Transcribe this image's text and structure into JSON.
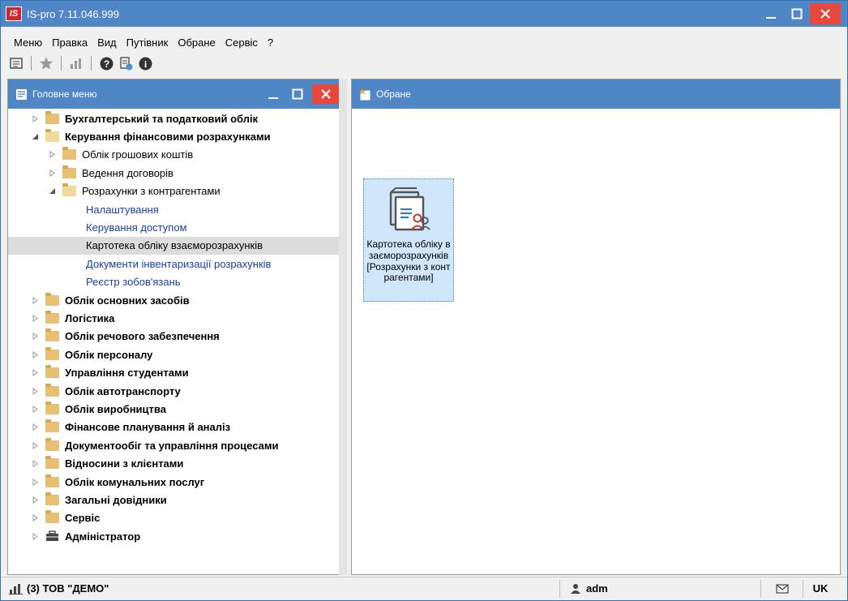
{
  "app": {
    "title": "IS-pro 7.11.046.999",
    "logo_text": "IS"
  },
  "menu": [
    "Меню",
    "Правка",
    "Вид",
    "Путівник",
    "Обране",
    "Сервіс",
    "?"
  ],
  "toolbar": {
    "icons": [
      "list-icon",
      "star-icon",
      "chart-icon",
      "help-icon",
      "info-doc-icon",
      "info-icon"
    ]
  },
  "left_panel": {
    "title": "Головне меню",
    "tree": [
      {
        "label": "Бухгалтерський та податковий облік",
        "level": 0,
        "bold": true,
        "expander": "collapsed",
        "icon": "folder"
      },
      {
        "label": "Керування фінансовими розрахунками",
        "level": 0,
        "bold": true,
        "expander": "expanded",
        "icon": "folder-open"
      },
      {
        "label": "Облік грошових коштів",
        "level": 1,
        "bold": false,
        "expander": "collapsed",
        "icon": "folder"
      },
      {
        "label": "Ведення договорів",
        "level": 1,
        "bold": false,
        "expander": "collapsed",
        "icon": "folder"
      },
      {
        "label": "Розрахунки з контрагентами",
        "level": 1,
        "bold": false,
        "expander": "expanded",
        "icon": "folder-open"
      },
      {
        "label": "Налаштування",
        "level": 2,
        "link": true
      },
      {
        "label": "Керування доступом",
        "level": 2,
        "link": true
      },
      {
        "label": "Картотека обліку взаєморозрахунків",
        "level": 2,
        "link": false,
        "selected": true
      },
      {
        "label": "Документи інвентаризації розрахунків",
        "level": 2,
        "link": true
      },
      {
        "label": "Реєстр зобов'язань",
        "level": 2,
        "link": true
      },
      {
        "label": "Облік основних засобів",
        "level": 0,
        "bold": true,
        "expander": "collapsed",
        "icon": "folder"
      },
      {
        "label": "Логістика",
        "level": 0,
        "bold": true,
        "expander": "collapsed",
        "icon": "folder"
      },
      {
        "label": "Облік речового забезпечення",
        "level": 0,
        "bold": true,
        "expander": "collapsed",
        "icon": "folder"
      },
      {
        "label": "Облік персоналу",
        "level": 0,
        "bold": true,
        "expander": "collapsed",
        "icon": "folder"
      },
      {
        "label": "Управління студентами",
        "level": 0,
        "bold": true,
        "expander": "collapsed",
        "icon": "folder"
      },
      {
        "label": "Облік автотранспорту",
        "level": 0,
        "bold": true,
        "expander": "collapsed",
        "icon": "folder"
      },
      {
        "label": "Облік виробництва",
        "level": 0,
        "bold": true,
        "expander": "collapsed",
        "icon": "folder"
      },
      {
        "label": "Фінансове планування й аналіз",
        "level": 0,
        "bold": true,
        "expander": "collapsed",
        "icon": "folder"
      },
      {
        "label": "Документообіг та управління процесами",
        "level": 0,
        "bold": true,
        "expander": "collapsed",
        "icon": "folder"
      },
      {
        "label": "Відносини з клієнтами",
        "level": 0,
        "bold": true,
        "expander": "collapsed",
        "icon": "folder"
      },
      {
        "label": "Облік комунальних послуг",
        "level": 0,
        "bold": true,
        "expander": "collapsed",
        "icon": "folder"
      },
      {
        "label": "Загальні довідники",
        "level": 0,
        "bold": true,
        "expander": "collapsed",
        "icon": "folder"
      },
      {
        "label": "Сервіс",
        "level": 0,
        "bold": true,
        "expander": "collapsed",
        "icon": "folder"
      },
      {
        "label": "Адміністратор",
        "level": 0,
        "bold": true,
        "expander": "collapsed",
        "icon": "admin"
      }
    ]
  },
  "right_panel": {
    "title": "Обране",
    "tile_label": "Картотека обліку взаєморозрахунків [Розрахунки з контрагентами]"
  },
  "statusbar": {
    "company": "(3) ТОВ \"ДЕМО\"",
    "user": "adm",
    "lang": "UK"
  },
  "colors": {
    "titlebar": "#4f86c6",
    "close": "#e8473c",
    "link": "#1a3fa8",
    "selected_row": "#dcdcdc",
    "tile_bg": "#cfe6fb"
  }
}
